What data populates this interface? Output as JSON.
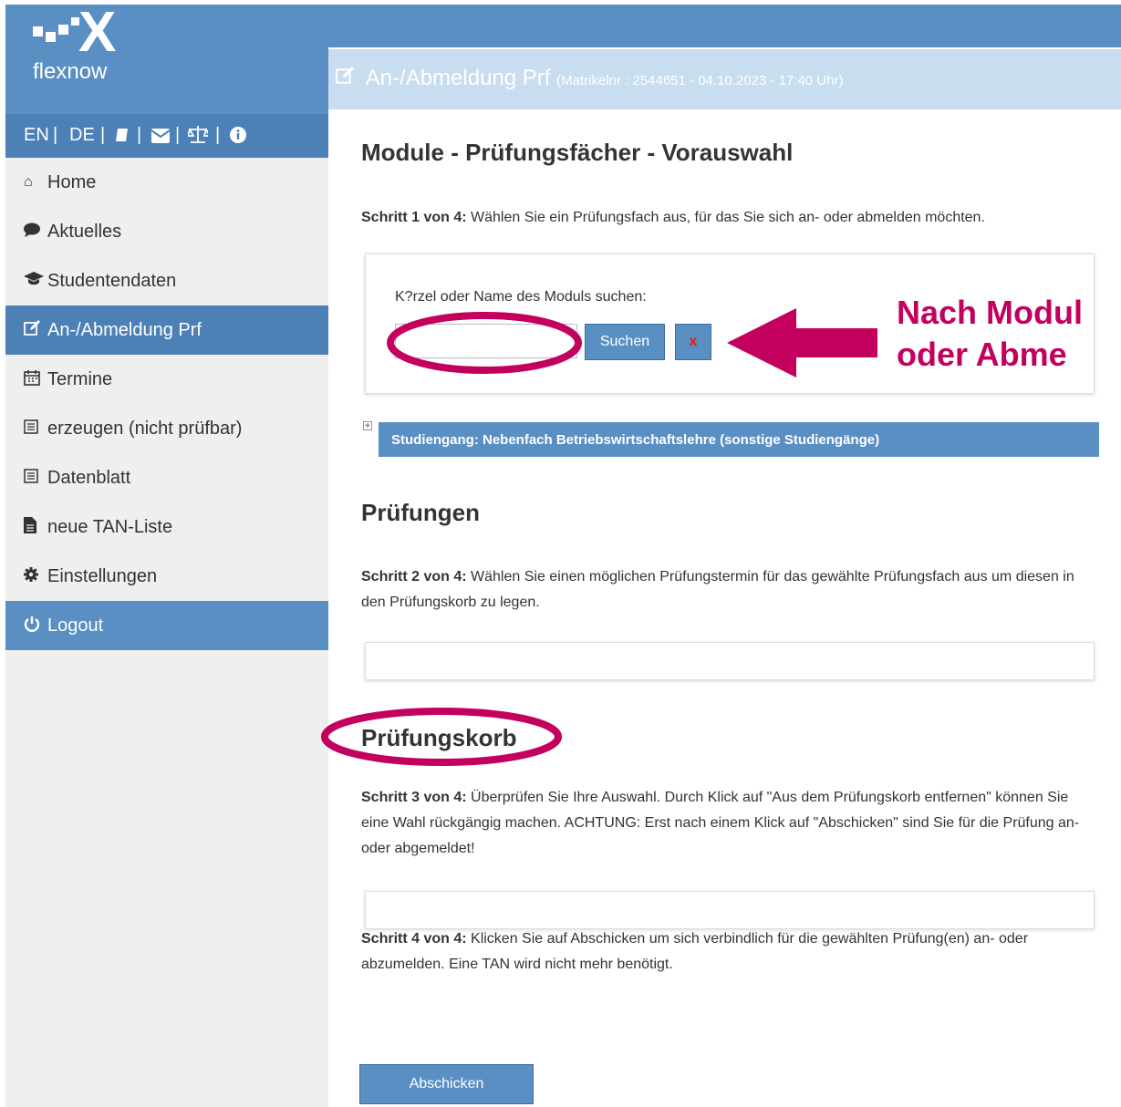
{
  "logo": {
    "text": "flexnow"
  },
  "langbar": {
    "items": [
      "EN",
      "|",
      "DE",
      "|",
      "|",
      "|",
      "|"
    ]
  },
  "nav": {
    "items": [
      {
        "label": "Home",
        "icon": "home-icon"
      },
      {
        "label": "Aktuelles",
        "icon": "speech-bubble-icon"
      },
      {
        "label": "Studentendaten",
        "icon": "graduation-cap-icon"
      },
      {
        "label": "An-/Abmeldung Prf",
        "icon": "edit-icon"
      },
      {
        "label": "Termine",
        "icon": "calendar-icon"
      },
      {
        "label": "erzeugen (nicht prüfbar)",
        "icon": "form-icon"
      },
      {
        "label": "Datenblatt",
        "icon": "form-icon"
      },
      {
        "label": "neue TAN-Liste",
        "icon": "document-icon"
      },
      {
        "label": "Einstellungen",
        "icon": "gear-icon"
      },
      {
        "label": "Logout",
        "icon": "power-icon"
      }
    ]
  },
  "header": {
    "title": "An-/Abmeldung Prf",
    "subtitle": "(Matrikelnr : 2544651 - 04.10.2023 - 17:40 Uhr)"
  },
  "section1": {
    "heading": "Module - Prüfungsfächer - Vorauswahl",
    "step_label": "Schritt 1 von 4:",
    "step_text": " Wählen Sie ein Prüfungsfach aus, für das Sie sich an- oder abmelden möchten."
  },
  "search": {
    "label": "K?rzel oder Name des Moduls suchen:",
    "value": "",
    "button_label": "Suchen",
    "clear_label": "x"
  },
  "annotation": {
    "line1": "Nach Modul",
    "line2": "oder Abme"
  },
  "studiengang": {
    "label": "Studiengang: Nebenfach Betriebswirtschaftslehre (sonstige Studiengänge)"
  },
  "section2": {
    "heading": "Prüfungen",
    "step_label": "Schritt 2 von 4:",
    "step_text": " Wählen Sie einen möglichen Prüfungstermin für das gewählte Prüfungsfach aus um diesen in den Prüfungskorb zu legen."
  },
  "section3": {
    "heading": "Prüfungskorb",
    "step_label": "Schritt 3 von 4:",
    "step_text": " Überprüfen Sie Ihre Auswahl. Durch Klick auf \"Aus dem Prüfungskorb entfernen\" können Sie eine Wahl rückgängig machen. ACHTUNG: Erst nach einem Klick auf \"Abschicken\" sind Sie für die Prüfung an- oder abgemeldet!"
  },
  "section4": {
    "step_label": "Schritt 4 von 4:",
    "step_text": " Klicken Sie auf Abschicken um sich verbindlich für die gewählten Prüfung(en) an- oder abzumelden. Eine TAN wird nicht mehr benötigt."
  },
  "submit": {
    "label": "Abschicken"
  },
  "colors": {
    "primary": "#5a8fc4",
    "active": "#4c80b7",
    "header_bg": "#c8ddf0",
    "annotation": "#c4005f"
  }
}
